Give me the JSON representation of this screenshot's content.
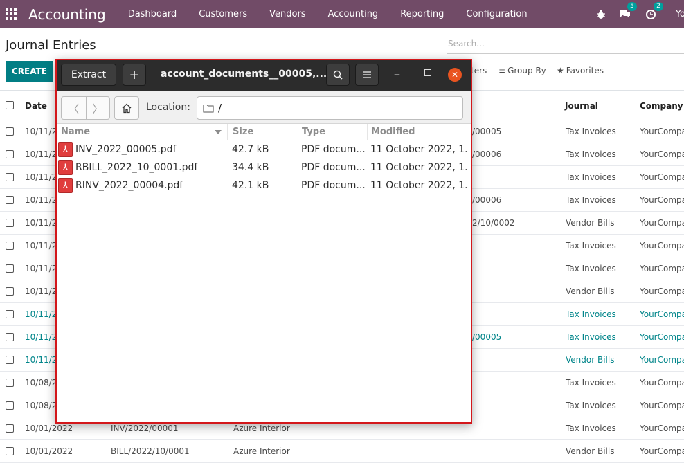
{
  "navbar": {
    "brand": "Accounting",
    "menu": [
      "Dashboard",
      "Customers",
      "Vendors",
      "Accounting",
      "Reporting",
      "Configuration"
    ],
    "chat_badge": "5",
    "activity_badge": "2",
    "user_initials": "Yo",
    "bg_color": "#714b67"
  },
  "control": {
    "title": "Journal Entries",
    "search_placeholder": "Search...",
    "create_label": "CREATE",
    "filters_label": "ters",
    "groupby_label": "Group By",
    "favorites_label": "Favorites"
  },
  "table": {
    "headers": {
      "date": "Date",
      "journal": "Journal",
      "company": "Company"
    },
    "rows": [
      {
        "date": "10/11/2",
        "number": "",
        "partner": "",
        "ref": "/00005",
        "journal": "Tax Invoices",
        "company": "YourCompa",
        "teal": false
      },
      {
        "date": "10/11/2",
        "number": "",
        "partner": "",
        "ref": "/00006",
        "journal": "Tax Invoices",
        "company": "YourCompa",
        "teal": false
      },
      {
        "date": "10/11/2",
        "number": "",
        "partner": "",
        "ref": "",
        "journal": "Tax Invoices",
        "company": "YourCompa",
        "teal": false
      },
      {
        "date": "10/11/2",
        "number": "",
        "partner": "",
        "ref": "/00006",
        "journal": "Tax Invoices",
        "company": "YourCompa",
        "teal": false
      },
      {
        "date": "10/11/2",
        "number": "",
        "partner": "",
        "ref": "2/10/0002",
        "journal": "Vendor Bills",
        "company": "YourCompa",
        "teal": false
      },
      {
        "date": "10/11/2",
        "number": "",
        "partner": "",
        "ref": "",
        "journal": "Tax Invoices",
        "company": "YourCompa",
        "teal": false
      },
      {
        "date": "10/11/2",
        "number": "",
        "partner": "",
        "ref": "",
        "journal": "Tax Invoices",
        "company": "YourCompa",
        "teal": false
      },
      {
        "date": "10/11/2",
        "number": "",
        "partner": "",
        "ref": "",
        "journal": "Vendor Bills",
        "company": "YourCompa",
        "teal": false
      },
      {
        "date": "10/11/2",
        "number": "",
        "partner": "",
        "ref": "",
        "journal": "Tax Invoices",
        "company": "YourCompa",
        "teal": true
      },
      {
        "date": "10/11/2",
        "number": "",
        "partner": "",
        "ref": "/00005",
        "journal": "Tax Invoices",
        "company": "YourCompa",
        "teal": true
      },
      {
        "date": "10/11/2",
        "number": "",
        "partner": "",
        "ref": "",
        "journal": "Vendor Bills",
        "company": "YourCompa",
        "teal": true
      },
      {
        "date": "10/08/2",
        "number": "",
        "partner": "",
        "ref": "",
        "journal": "Tax Invoices",
        "company": "YourCompa",
        "teal": false
      },
      {
        "date": "10/08/2",
        "number": "",
        "partner": "",
        "ref": "",
        "journal": "Tax Invoices",
        "company": "YourCompa",
        "teal": false
      },
      {
        "date": "10/01/2022",
        "number": "INV/2022/00001",
        "partner": "Azure Interior",
        "ref": "",
        "journal": "Tax Invoices",
        "company": "YourCompa",
        "teal": false
      },
      {
        "date": "10/01/2022",
        "number": "BILL/2022/10/0001",
        "partner": "Azure Interior",
        "ref": "",
        "journal": "Vendor Bills",
        "company": "YourCompa",
        "teal": false
      }
    ]
  },
  "dialog": {
    "extract_label": "Extract",
    "plus_label": "+",
    "title": "account_documents__00005,...",
    "location_label": "Location:",
    "location_path": "/",
    "columns": {
      "name": "Name",
      "size": "Size",
      "type": "Type",
      "modified": "Modified"
    },
    "files": [
      {
        "name": "INV_2022_00005.pdf",
        "size": "42.7 kB",
        "type": "PDF docum...",
        "modified": "11 October 2022, 1..."
      },
      {
        "name": "RBILL_2022_10_0001.pdf",
        "size": "34.4 kB",
        "type": "PDF docum...",
        "modified": "11 October 2022, 1..."
      },
      {
        "name": "RINV_2022_00004.pdf",
        "size": "42.1 kB",
        "type": "PDF docum...",
        "modified": "11 October 2022, 1..."
      }
    ],
    "accent_close": "#e95420",
    "border_color": "#d3171b"
  }
}
